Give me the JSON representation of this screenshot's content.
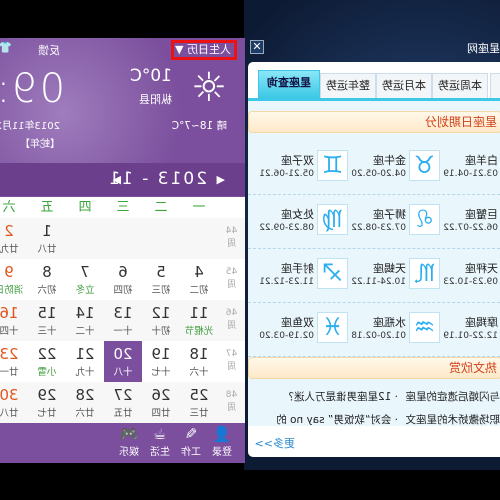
{
  "constellation": {
    "title": "星座网",
    "close_icon": "close-icon",
    "tabs": [
      "运势",
      "本周运势",
      "本月运势",
      "整年运势",
      "星座查询"
    ],
    "active_tab": "星座查询",
    "section1": "星座日期划分",
    "signs": [
      [
        {
          "name": "白羊座",
          "date": "03.21-04.19",
          "sym": "♈"
        },
        {
          "name": "金牛座",
          "date": "04.20-05.20",
          "sym": "♉"
        },
        {
          "name": "双子座",
          "date": "05.21-06.21",
          "sym": "♊"
        }
      ],
      [
        {
          "name": "巨蟹座",
          "date": "06.22-07.22",
          "sym": "♋"
        },
        {
          "name": "狮子座",
          "date": "07.23-08.22",
          "sym": "♌"
        },
        {
          "name": "处女座",
          "date": "08.23-09.22",
          "sym": "♍"
        }
      ],
      [
        {
          "name": "天秤座",
          "date": "09.23-10.23",
          "sym": "♎"
        },
        {
          "name": "天蝎座",
          "date": "10.24-11.22",
          "sym": "♏"
        },
        {
          "name": "射手座",
          "date": "11.23-12.21",
          "sym": "♐"
        }
      ],
      [
        {
          "name": "摩羯座",
          "date": "12.22-01.19",
          "sym": "♑"
        },
        {
          "name": "水瓶座",
          "date": "01.20-02.18",
          "sym": "♒"
        },
        {
          "name": "双鱼座",
          "date": "02.19-03.20",
          "sym": "♓"
        }
      ]
    ],
    "section2": "热文欣赏",
    "articles": [
      "与闪婚后遗症的星座",
      "· 12星座男谁是万人迷？",
      "职场撒娇术的星座文",
      "· 会对“软饭男” say no 的"
    ],
    "more": "更多>>",
    "accent": "#3cc8e6"
  },
  "calendar": {
    "app_button": "人生日历 ▼",
    "feedback": "反馈",
    "skin_icon": "shirt-icon",
    "weather": {
      "icon": "sun-icon",
      "temp": "10°C",
      "city": "枞阳县",
      "forecast": "晴 18~7°C"
    },
    "clock": "09:5",
    "date": "2013年11月2",
    "zodiac_year": "【蛇年】",
    "nav": {
      "prev": "◀",
      "year_month": "2013 - 11",
      "next": "▶"
    },
    "weekdays": [
      "一",
      "二",
      "三",
      "四",
      "五",
      "六",
      "日"
    ],
    "weeks": [
      {
        "no": "44",
        "label": "周",
        "days": [
          null,
          null,
          null,
          null,
          {
            "n": "1",
            "l": "廿八"
          },
          {
            "n": "2",
            "l": "廿九"
          }
        ]
      },
      {
        "no": "45",
        "label": "周",
        "days": [
          {
            "n": "4",
            "l": "初二"
          },
          {
            "n": "5",
            "l": "初三"
          },
          {
            "n": "6",
            "l": "初四"
          },
          {
            "n": "7",
            "l": "立冬",
            "hol": true
          },
          {
            "n": "8",
            "l": "初六"
          },
          {
            "n": "9",
            "l": "消防日",
            "hol": true
          }
        ]
      },
      {
        "no": "46",
        "label": "周",
        "days": [
          {
            "n": "11",
            "l": "光棍节",
            "hol": true
          },
          {
            "n": "12",
            "l": "初十"
          },
          {
            "n": "13",
            "l": "十一"
          },
          {
            "n": "14",
            "l": "十二"
          },
          {
            "n": "15",
            "l": "十三"
          },
          {
            "n": "16",
            "l": "十四"
          }
        ]
      },
      {
        "no": "47",
        "label": "周",
        "days": [
          {
            "n": "18",
            "l": "十六"
          },
          {
            "n": "19",
            "l": "十七"
          },
          {
            "n": "20",
            "l": "十八",
            "sel": true
          },
          {
            "n": "21",
            "l": "十九"
          },
          {
            "n": "22",
            "l": "小雪",
            "hol": true
          },
          {
            "n": "23",
            "l": "廿一"
          }
        ]
      },
      {
        "no": "48",
        "label": "周",
        "days": [
          {
            "n": "25",
            "l": "廿三"
          },
          {
            "n": "26",
            "l": "廿四"
          },
          {
            "n": "27",
            "l": "廿五"
          },
          {
            "n": "28",
            "l": "廿六"
          },
          {
            "n": "29",
            "l": "廿七"
          },
          {
            "n": "30",
            "l": "廿八"
          }
        ]
      }
    ],
    "bottom": [
      {
        "icon": "user-icon",
        "g": "👤",
        "label": "登录"
      },
      {
        "icon": "note-icon",
        "g": "✎",
        "label": "工作"
      },
      {
        "icon": "coffee-icon",
        "g": "☕",
        "label": "生活"
      },
      {
        "icon": "gamepad-icon",
        "g": "🎮",
        "label": "娱乐"
      }
    ],
    "accent": "#7b4f9d"
  }
}
